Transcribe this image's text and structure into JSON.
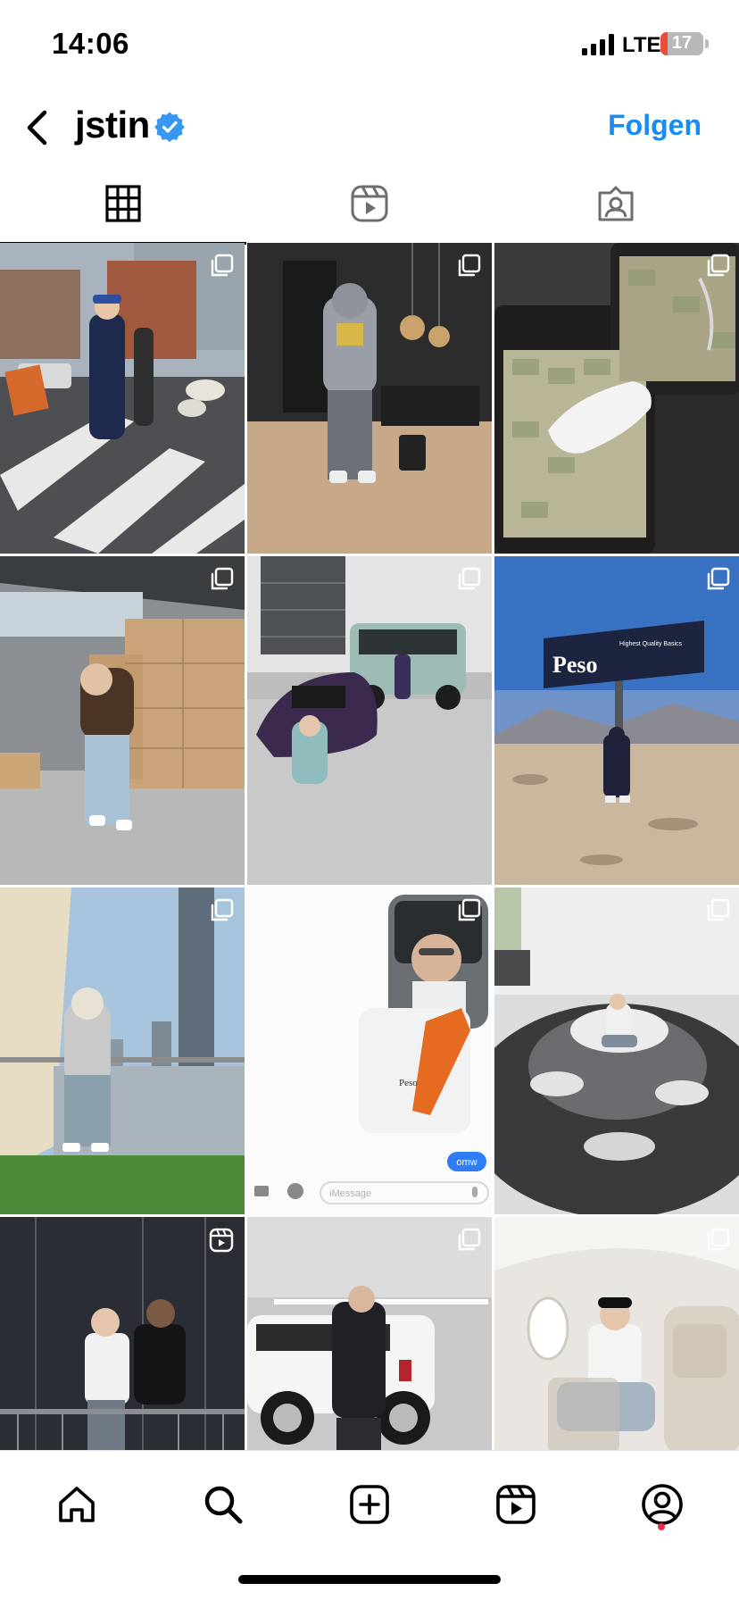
{
  "status_bar": {
    "time": "14:06",
    "network": "LTE",
    "battery": "17",
    "battery_level": 0.17
  },
  "header": {
    "username": "jstin",
    "follow_label": "Folgen"
  },
  "tabs": [
    {
      "name": "posts",
      "icon": "grid-icon",
      "active": true
    },
    {
      "name": "reels",
      "icon": "reels-icon",
      "active": false
    },
    {
      "name": "tagged",
      "icon": "tagged-icon",
      "active": false
    }
  ],
  "posts": [
    {
      "scene": "street-crosswalk",
      "badge": "carousel-icon"
    },
    {
      "scene": "billiard-room",
      "badge": "carousel-icon"
    },
    {
      "scene": "money-suitcase",
      "badge": "carousel-icon"
    },
    {
      "scene": "warehouse-boxes",
      "badge": "carousel-icon"
    },
    {
      "scene": "garage-cars",
      "badge": "carousel-icon"
    },
    {
      "scene": "desert-billboard",
      "badge": "carousel-icon"
    },
    {
      "scene": "balcony-skyline",
      "badge": "carousel-icon"
    },
    {
      "scene": "imessage-screenshot",
      "badge": "carousel-icon"
    },
    {
      "scene": "jackets-pile",
      "badge": "carousel-icon"
    },
    {
      "scene": "studio-handshake",
      "badge": "reel-icon"
    },
    {
      "scene": "white-suv",
      "badge": "carousel-icon"
    },
    {
      "scene": "private-jet",
      "badge": "carousel-icon"
    }
  ],
  "post_texts": {
    "billboard": "Peso",
    "billboard_tagline": "Highest Quality Basics",
    "hoodie": "Peso",
    "message": "omw",
    "imessage_placeholder": "iMessage"
  },
  "nav": [
    {
      "name": "home",
      "icon": "home-icon"
    },
    {
      "name": "search",
      "icon": "search-icon"
    },
    {
      "name": "create",
      "icon": "create-icon"
    },
    {
      "name": "reels",
      "icon": "reels-icon"
    },
    {
      "name": "profile",
      "icon": "profile-icon"
    }
  ],
  "colors": {
    "accent": "#1a8cf1",
    "verified": "#3897f0",
    "notification": "#ee2c4a"
  }
}
